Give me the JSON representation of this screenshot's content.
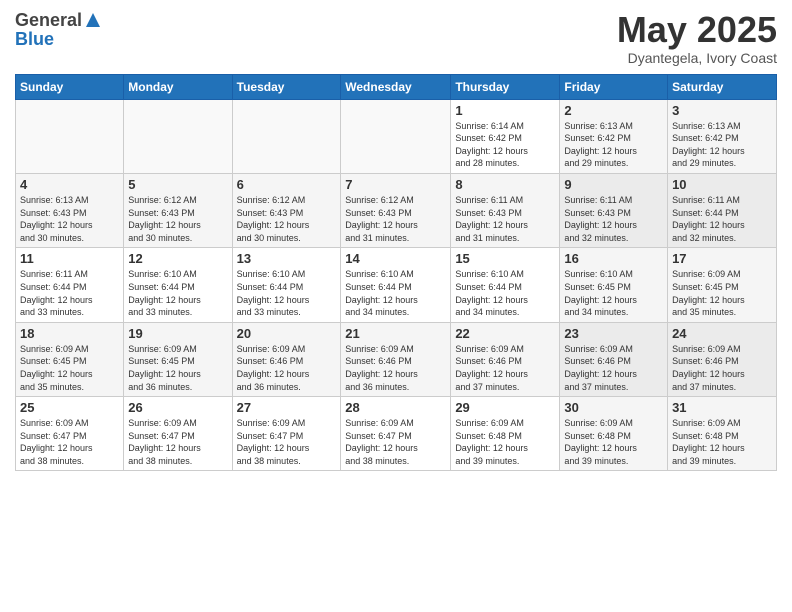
{
  "header": {
    "logo_line1": "General",
    "logo_line2": "Blue",
    "month": "May 2025",
    "location": "Dyantegela, Ivory Coast"
  },
  "days_of_week": [
    "Sunday",
    "Monday",
    "Tuesday",
    "Wednesday",
    "Thursday",
    "Friday",
    "Saturday"
  ],
  "weeks": [
    [
      {
        "day": "",
        "info": ""
      },
      {
        "day": "",
        "info": ""
      },
      {
        "day": "",
        "info": ""
      },
      {
        "day": "",
        "info": ""
      },
      {
        "day": "1",
        "info": "Sunrise: 6:14 AM\nSunset: 6:42 PM\nDaylight: 12 hours\nand 28 minutes."
      },
      {
        "day": "2",
        "info": "Sunrise: 6:13 AM\nSunset: 6:42 PM\nDaylight: 12 hours\nand 29 minutes."
      },
      {
        "day": "3",
        "info": "Sunrise: 6:13 AM\nSunset: 6:42 PM\nDaylight: 12 hours\nand 29 minutes."
      }
    ],
    [
      {
        "day": "4",
        "info": "Sunrise: 6:13 AM\nSunset: 6:43 PM\nDaylight: 12 hours\nand 30 minutes."
      },
      {
        "day": "5",
        "info": "Sunrise: 6:12 AM\nSunset: 6:43 PM\nDaylight: 12 hours\nand 30 minutes."
      },
      {
        "day": "6",
        "info": "Sunrise: 6:12 AM\nSunset: 6:43 PM\nDaylight: 12 hours\nand 30 minutes."
      },
      {
        "day": "7",
        "info": "Sunrise: 6:12 AM\nSunset: 6:43 PM\nDaylight: 12 hours\nand 31 minutes."
      },
      {
        "day": "8",
        "info": "Sunrise: 6:11 AM\nSunset: 6:43 PM\nDaylight: 12 hours\nand 31 minutes."
      },
      {
        "day": "9",
        "info": "Sunrise: 6:11 AM\nSunset: 6:43 PM\nDaylight: 12 hours\nand 32 minutes."
      },
      {
        "day": "10",
        "info": "Sunrise: 6:11 AM\nSunset: 6:44 PM\nDaylight: 12 hours\nand 32 minutes."
      }
    ],
    [
      {
        "day": "11",
        "info": "Sunrise: 6:11 AM\nSunset: 6:44 PM\nDaylight: 12 hours\nand 33 minutes."
      },
      {
        "day": "12",
        "info": "Sunrise: 6:10 AM\nSunset: 6:44 PM\nDaylight: 12 hours\nand 33 minutes."
      },
      {
        "day": "13",
        "info": "Sunrise: 6:10 AM\nSunset: 6:44 PM\nDaylight: 12 hours\nand 33 minutes."
      },
      {
        "day": "14",
        "info": "Sunrise: 6:10 AM\nSunset: 6:44 PM\nDaylight: 12 hours\nand 34 minutes."
      },
      {
        "day": "15",
        "info": "Sunrise: 6:10 AM\nSunset: 6:44 PM\nDaylight: 12 hours\nand 34 minutes."
      },
      {
        "day": "16",
        "info": "Sunrise: 6:10 AM\nSunset: 6:45 PM\nDaylight: 12 hours\nand 34 minutes."
      },
      {
        "day": "17",
        "info": "Sunrise: 6:09 AM\nSunset: 6:45 PM\nDaylight: 12 hours\nand 35 minutes."
      }
    ],
    [
      {
        "day": "18",
        "info": "Sunrise: 6:09 AM\nSunset: 6:45 PM\nDaylight: 12 hours\nand 35 minutes."
      },
      {
        "day": "19",
        "info": "Sunrise: 6:09 AM\nSunset: 6:45 PM\nDaylight: 12 hours\nand 36 minutes."
      },
      {
        "day": "20",
        "info": "Sunrise: 6:09 AM\nSunset: 6:46 PM\nDaylight: 12 hours\nand 36 minutes."
      },
      {
        "day": "21",
        "info": "Sunrise: 6:09 AM\nSunset: 6:46 PM\nDaylight: 12 hours\nand 36 minutes."
      },
      {
        "day": "22",
        "info": "Sunrise: 6:09 AM\nSunset: 6:46 PM\nDaylight: 12 hours\nand 37 minutes."
      },
      {
        "day": "23",
        "info": "Sunrise: 6:09 AM\nSunset: 6:46 PM\nDaylight: 12 hours\nand 37 minutes."
      },
      {
        "day": "24",
        "info": "Sunrise: 6:09 AM\nSunset: 6:46 PM\nDaylight: 12 hours\nand 37 minutes."
      }
    ],
    [
      {
        "day": "25",
        "info": "Sunrise: 6:09 AM\nSunset: 6:47 PM\nDaylight: 12 hours\nand 38 minutes."
      },
      {
        "day": "26",
        "info": "Sunrise: 6:09 AM\nSunset: 6:47 PM\nDaylight: 12 hours\nand 38 minutes."
      },
      {
        "day": "27",
        "info": "Sunrise: 6:09 AM\nSunset: 6:47 PM\nDaylight: 12 hours\nand 38 minutes."
      },
      {
        "day": "28",
        "info": "Sunrise: 6:09 AM\nSunset: 6:47 PM\nDaylight: 12 hours\nand 38 minutes."
      },
      {
        "day": "29",
        "info": "Sunrise: 6:09 AM\nSunset: 6:48 PM\nDaylight: 12 hours\nand 39 minutes."
      },
      {
        "day": "30",
        "info": "Sunrise: 6:09 AM\nSunset: 6:48 PM\nDaylight: 12 hours\nand 39 minutes."
      },
      {
        "day": "31",
        "info": "Sunrise: 6:09 AM\nSunset: 6:48 PM\nDaylight: 12 hours\nand 39 minutes."
      }
    ]
  ]
}
